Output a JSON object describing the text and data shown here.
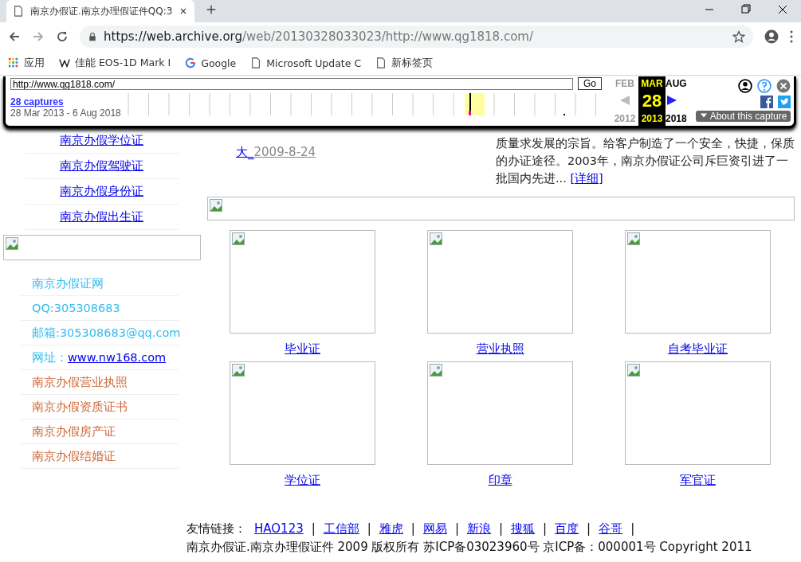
{
  "browser": {
    "tab_title": "南京办假证.南京办理假证件QQ:3",
    "url_host": "https://web.archive.org",
    "url_path": "/web/20130328033023/http://www.qg1818.com/",
    "bookmarks": [
      {
        "kind": "apps",
        "label": "应用"
      },
      {
        "kind": "wiki",
        "label": "佳能 EOS-1D Mark I"
      },
      {
        "kind": "google",
        "label": "Google"
      },
      {
        "kind": "page",
        "label": "Microsoft Update C"
      },
      {
        "kind": "page",
        "label": "新标签页"
      }
    ]
  },
  "wayback": {
    "url_value": "http://www.qg1818.com/",
    "go": "Go",
    "captures": "28 captures",
    "range": "28 Mar 2013 - 6 Aug 2018",
    "months": [
      {
        "month": "FEB",
        "year": "2012",
        "selected": false
      },
      {
        "month": "MAR",
        "day": "28",
        "year": "2013",
        "selected": true
      },
      {
        "month": "AUG",
        "year": "2018",
        "selected": false
      }
    ],
    "about": "About this capture"
  },
  "left_links": [
    "南京办假学位证",
    "南京办假驾驶证",
    "南京办假身份证",
    "南京办假出生证"
  ],
  "left_list": [
    {
      "kind": "contact",
      "text": "南京办假证网"
    },
    {
      "kind": "contact",
      "text": "QQ:305308683"
    },
    {
      "kind": "contact",
      "text": "邮箱:305308683@qq.com"
    },
    {
      "kind": "url",
      "text": "网址：",
      "link": "www.nw168.com"
    },
    {
      "kind": "service",
      "text": "南京办假营业执照"
    },
    {
      "kind": "service",
      "text": "南京办假资质证书"
    },
    {
      "kind": "service",
      "text": "南京办假房产证"
    },
    {
      "kind": "service",
      "text": "南京办假结婚证"
    }
  ],
  "news_tail": {
    "link": "大_",
    "date": "2009-8-24"
  },
  "intro": {
    "text": "质量求发展的宗旨。给客户制造了一个安全，快捷，保质的办证途径。2003年，南京办假证公司斥巨资引进了一批国内先进...",
    "more": "[详细]"
  },
  "products": [
    {
      "caption": "毕业证"
    },
    {
      "caption": "营业执照"
    },
    {
      "caption": "自考毕业证"
    },
    {
      "caption": "学位证"
    },
    {
      "caption": "印章"
    },
    {
      "caption": "军官证"
    }
  ],
  "footer": {
    "label": "友情链接：",
    "separator": "|",
    "links": [
      "HAO123",
      "工信部",
      "雅虎",
      "网易",
      "新浪",
      "搜狐",
      "百度",
      "谷哥"
    ],
    "copyright": "南京办假证.南京办理假证件 2009 版权所有 苏ICP备03023960号 京ICP备：000001号 Copyright 2011"
  }
}
